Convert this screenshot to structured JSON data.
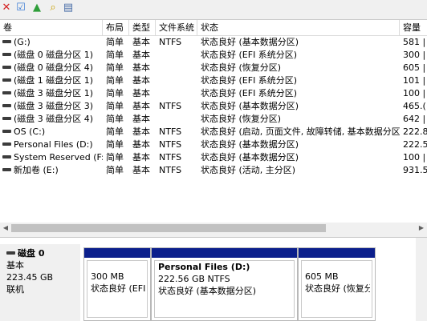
{
  "toolbar": {
    "icons": [
      {
        "name": "delete-icon",
        "glyph": "✕",
        "color": "#d42020"
      },
      {
        "name": "check-disk-icon",
        "glyph": "☑",
        "color": "#3a7bd5"
      },
      {
        "name": "folder-up-icon",
        "glyph": "▲",
        "color": "#2f9e3a"
      },
      {
        "name": "folder-search-icon",
        "glyph": "⌕",
        "color": "#c9a000"
      },
      {
        "name": "properties-icon",
        "glyph": "▤",
        "color": "#4a6ea8"
      }
    ]
  },
  "columns": {
    "volume": "卷",
    "layout": "布局",
    "type": "类型",
    "filesystem": "文件系统",
    "status": "状态",
    "capacity": "容量"
  },
  "volumes": [
    {
      "name": "(G:)",
      "layout": "简单",
      "type": "基本",
      "fs": "NTFS",
      "status": "状态良好 (基本数据分区)",
      "capacity": "581 |"
    },
    {
      "name": "(磁盘 0 磁盘分区 1)",
      "layout": "简单",
      "type": "基本",
      "fs": "",
      "status": "状态良好 (EFI 系统分区)",
      "capacity": "300 |"
    },
    {
      "name": "(磁盘 0 磁盘分区 4)",
      "layout": "简单",
      "type": "基本",
      "fs": "",
      "status": "状态良好 (恢复分区)",
      "capacity": "605 |"
    },
    {
      "name": "(磁盘 1 磁盘分区 1)",
      "layout": "简单",
      "type": "基本",
      "fs": "",
      "status": "状态良好 (EFI 系统分区)",
      "capacity": "101 |"
    },
    {
      "name": "(磁盘 3 磁盘分区 1)",
      "layout": "简单",
      "type": "基本",
      "fs": "",
      "status": "状态良好 (EFI 系统分区)",
      "capacity": "100 |"
    },
    {
      "name": "(磁盘 3 磁盘分区 3)",
      "layout": "简单",
      "type": "基本",
      "fs": "NTFS",
      "status": "状态良好 (基本数据分区)",
      "capacity": "465.("
    },
    {
      "name": "(磁盘 3 磁盘分区 4)",
      "layout": "简单",
      "type": "基本",
      "fs": "",
      "status": "状态良好 (恢复分区)",
      "capacity": "642 |"
    },
    {
      "name": "OS (C:)",
      "layout": "简单",
      "type": "基本",
      "fs": "NTFS",
      "status": "状态良好 (启动, 页面文件, 故障转储, 基本数据分区)",
      "capacity": "222.8"
    },
    {
      "name": "Personal Files (D:)",
      "layout": "简单",
      "type": "基本",
      "fs": "NTFS",
      "status": "状态良好 (基本数据分区)",
      "capacity": "222.5"
    },
    {
      "name": "System Reserved (F:)",
      "layout": "简单",
      "type": "基本",
      "fs": "NTFS",
      "status": "状态良好 (基本数据分区)",
      "capacity": "100 |"
    },
    {
      "name": "新加卷 (E:)",
      "layout": "简单",
      "type": "基本",
      "fs": "NTFS",
      "status": "状态良好 (活动, 主分区)",
      "capacity": "931.5"
    }
  ],
  "disk": {
    "name": "磁盘 0",
    "type": "基本",
    "size": "223.45 GB",
    "state": "联机"
  },
  "partitions": [
    {
      "title": "",
      "size": "300 MB",
      "status": "状态良好 (EFI 系"
    },
    {
      "title": "Personal Files (D:)",
      "size": "222.56 GB NTFS",
      "status": "状态良好 (基本数据分区)"
    },
    {
      "title": "",
      "size": "605 MB",
      "status": "状态良好 (恢复分区)"
    }
  ]
}
